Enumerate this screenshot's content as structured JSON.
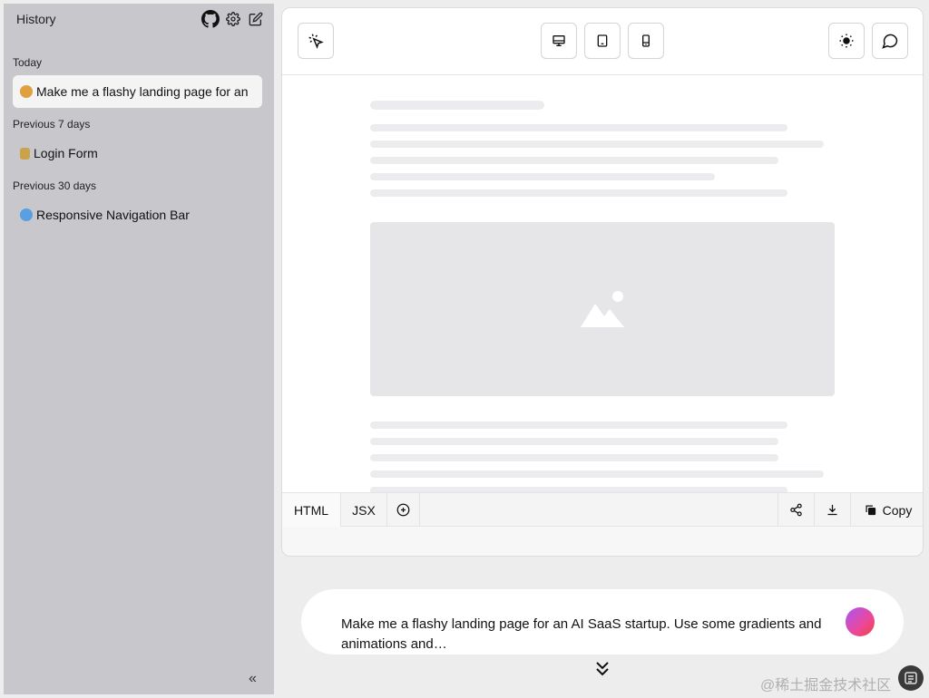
{
  "sidebar": {
    "title": "History",
    "sections": [
      {
        "label": "Today",
        "items": [
          {
            "label": "Make me a flashy landing page for an",
            "emoji": "🤩",
            "active": true
          }
        ]
      },
      {
        "label": "Previous 7 days",
        "items": [
          {
            "label": "Login Form",
            "emoji": "🔒",
            "active": false
          }
        ]
      },
      {
        "label": "Previous 30 days",
        "items": [
          {
            "label": "Responsive Navigation Bar",
            "emoji": "🌐",
            "active": false
          }
        ]
      }
    ],
    "collapse_glyph": "«"
  },
  "icons": {
    "github": "github-icon",
    "settings": "gear-icon",
    "new_chat": "edit-icon",
    "select": "cursor-click-icon",
    "desktop": "desktop-icon",
    "tablet": "tablet-icon",
    "mobile": "mobile-icon",
    "theme": "sun-icon",
    "chat": "chat-bubble-icon",
    "share": "share-icon",
    "download": "download-icon",
    "copy": "copy-icon",
    "add": "plus-circle-icon",
    "scroll": "double-chevron-down-icon",
    "image_placeholder": "image-placeholder-icon"
  },
  "code_bar": {
    "tabs": [
      "HTML",
      "JSX"
    ],
    "copy_label": "Copy"
  },
  "prompt": {
    "text": "Make me a flashy landing page for an AI SaaS startup.  Use some gradients and animations and…"
  },
  "watermark": "@稀土掘金技术社区",
  "colors": {
    "sidebar_bg": "#c8c8cc",
    "send_gradient_start": "#a855f7",
    "send_gradient_end": "#ef4444"
  }
}
